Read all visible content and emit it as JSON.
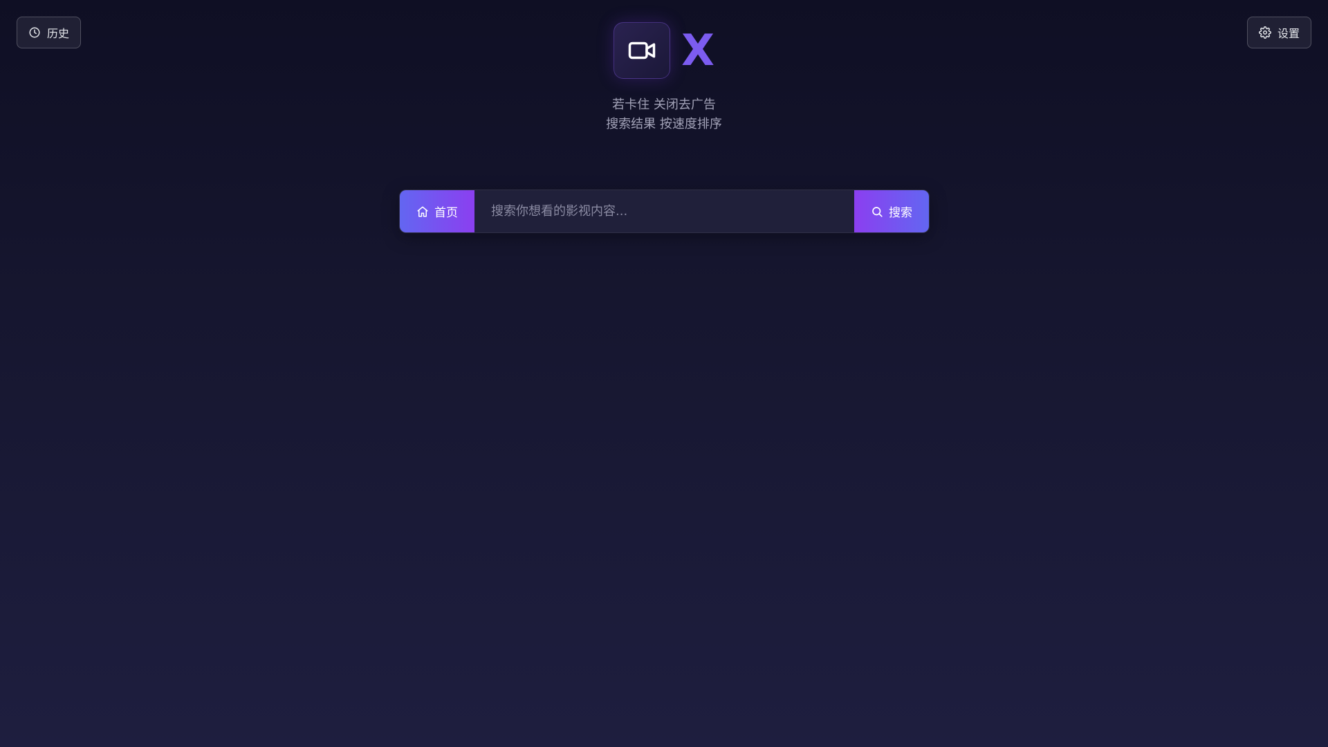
{
  "header": {
    "history_label": "历史",
    "history_icon": "clock-icon",
    "settings_label": "设置",
    "settings_icon": "gear-icon"
  },
  "brand": {
    "logo_icon": "video-camera-icon",
    "name": "X",
    "accent_color": "#7c5cf0"
  },
  "subtitle": {
    "line1": "若卡住 关闭去广告",
    "line2": "搜索结果 按速度排序"
  },
  "search": {
    "home_label": "首页",
    "home_icon": "home-icon",
    "placeholder": "搜索你想看的影视内容...",
    "value": "",
    "button_label": "搜索",
    "button_icon": "search-icon"
  },
  "colors": {
    "gradient_start": "#6366f1",
    "gradient_end": "#8b3ff0",
    "background_top": "#0f0f24",
    "background_bottom": "#1e1e3f"
  }
}
